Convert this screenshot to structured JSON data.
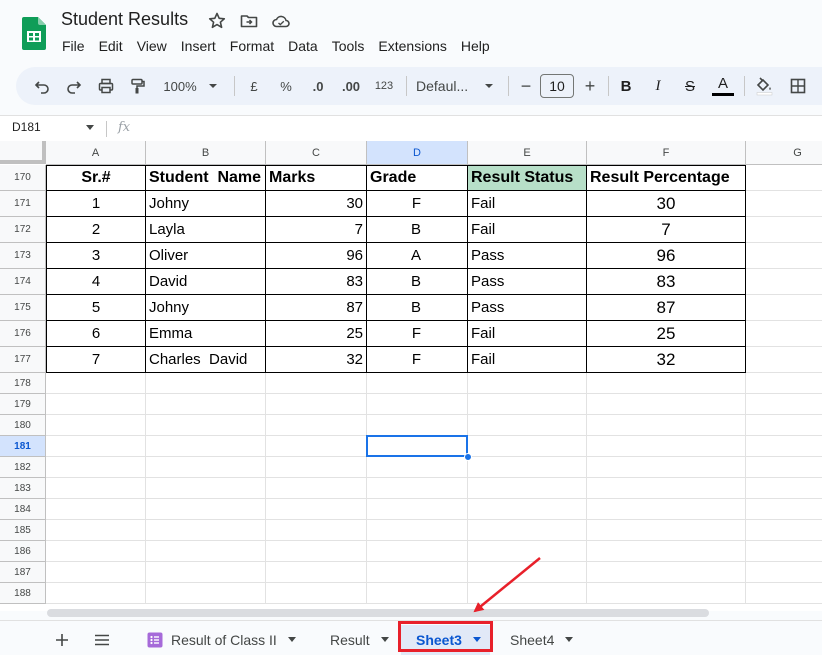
{
  "app": {
    "title": "Student Results",
    "menu": [
      "File",
      "Edit",
      "View",
      "Insert",
      "Format",
      "Data",
      "Tools",
      "Extensions",
      "Help"
    ]
  },
  "toolbar": {
    "zoom": "100%",
    "currency": "£",
    "percent": "%",
    "decrease_decimal": ".0",
    "increase_decimal": ".00",
    "number_format": "123",
    "font": "Defaul...",
    "font_size": "10",
    "minus": "−",
    "plus": "+",
    "bold": "B",
    "italic": "I",
    "strikethrough": "S",
    "text_color": "A"
  },
  "formula_bar": {
    "name_box": "D181",
    "fx": "fx"
  },
  "columns": [
    "A",
    "B",
    "C",
    "D",
    "E",
    "F",
    "G"
  ],
  "selected_column": "D",
  "rows": [
    "170",
    "171",
    "172",
    "173",
    "174",
    "175",
    "176",
    "177",
    "178",
    "179",
    "180",
    "181",
    "182",
    "183",
    "184",
    "185",
    "186",
    "187",
    "188"
  ],
  "selected_row": "181",
  "table": {
    "headers": [
      "Sr.#",
      "Student  Name",
      "Marks",
      "Grade",
      "Result Status",
      "Result Percentage"
    ],
    "rows": [
      [
        "1",
        "Johny",
        "30",
        "F",
        "Fail",
        "30"
      ],
      [
        "2",
        "Layla",
        "7",
        "B",
        "Fail",
        "7"
      ],
      [
        "3",
        "Oliver",
        "96",
        "A",
        "Pass",
        "96"
      ],
      [
        "4",
        "David",
        "83",
        "B",
        "Pass",
        "83"
      ],
      [
        "5",
        "Johny",
        "87",
        "B",
        "Pass",
        "87"
      ],
      [
        "6",
        "Emma",
        "25",
        "F",
        "Fail",
        "25"
      ],
      [
        "7",
        "Charles  David",
        "32",
        "F",
        "Fail",
        "32"
      ]
    ]
  },
  "sheets": [
    {
      "name": "Result of Class II",
      "active": false
    },
    {
      "name": "Result",
      "active": false
    },
    {
      "name": "Sheet3",
      "active": true
    },
    {
      "name": "Sheet4",
      "active": false
    }
  ],
  "colors": {
    "accent": "#0b57d0",
    "status_header_fill": "#b7dfc8",
    "highlight_box": "#e8202a",
    "selection": "#1a73e8"
  }
}
